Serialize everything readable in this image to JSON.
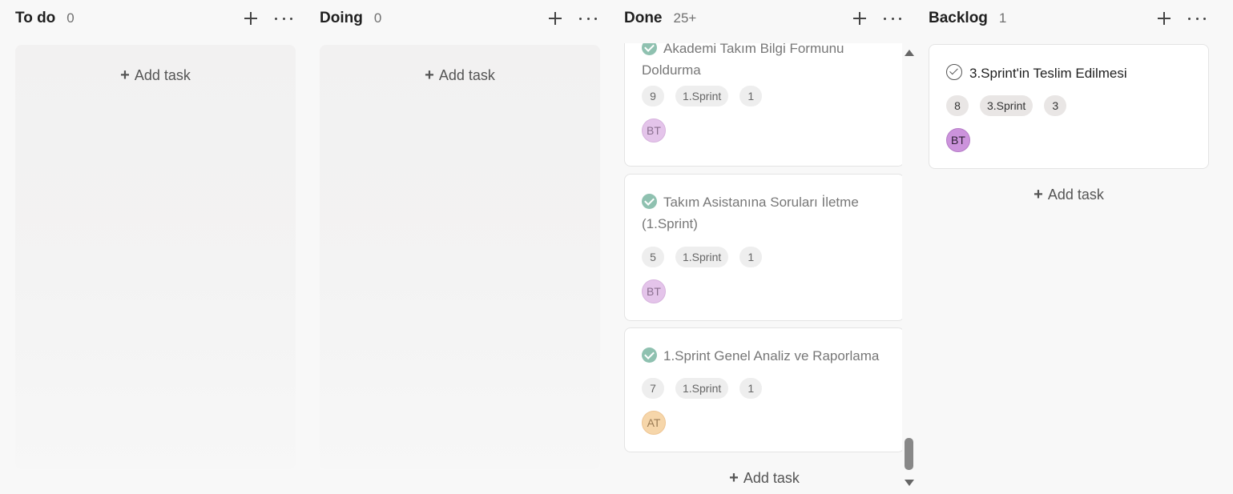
{
  "columns": {
    "todo": {
      "title": "To do",
      "count": "0",
      "add_task": "Add task"
    },
    "doing": {
      "title": "Doing",
      "count": "0",
      "add_task": "Add task"
    },
    "done": {
      "title": "Done",
      "count": "25+",
      "add_task": "Add task",
      "cards": [
        {
          "title_line1": "Akademi Takım Bilgi Formunu",
          "title_line2": "Doldurma",
          "tags": [
            "9",
            "1.Sprint",
            "1"
          ],
          "assignee": "BT"
        },
        {
          "title_line1": "Takım Asistanına Soruları İletme",
          "title_line2": "(1.Sprint)",
          "tags": [
            "5",
            "1.Sprint",
            "1"
          ],
          "assignee": "BT"
        },
        {
          "title_line1": "1.Sprint Genel Analiz ve Raporlama",
          "tags": [
            "7",
            "1.Sprint",
            "1"
          ],
          "assignee": "AT"
        }
      ]
    },
    "backlog": {
      "title": "Backlog",
      "count": "1",
      "add_task": "Add task",
      "cards": [
        {
          "title": "3.Sprint'in Teslim Edilmesi",
          "tags": [
            "8",
            "3.Sprint",
            "3"
          ],
          "assignee": "BT"
        }
      ]
    }
  },
  "icons": {
    "add": "plus-icon",
    "more": "ellipsis-icon",
    "done_check": "check-circle-filled-icon",
    "open_check": "check-circle-outline-icon"
  },
  "colors": {
    "done_check": "#8fc1b0",
    "avatar_bt": "#cc93dc",
    "avatar_at": "#f6d6aa",
    "background": "#f8f8f8"
  }
}
